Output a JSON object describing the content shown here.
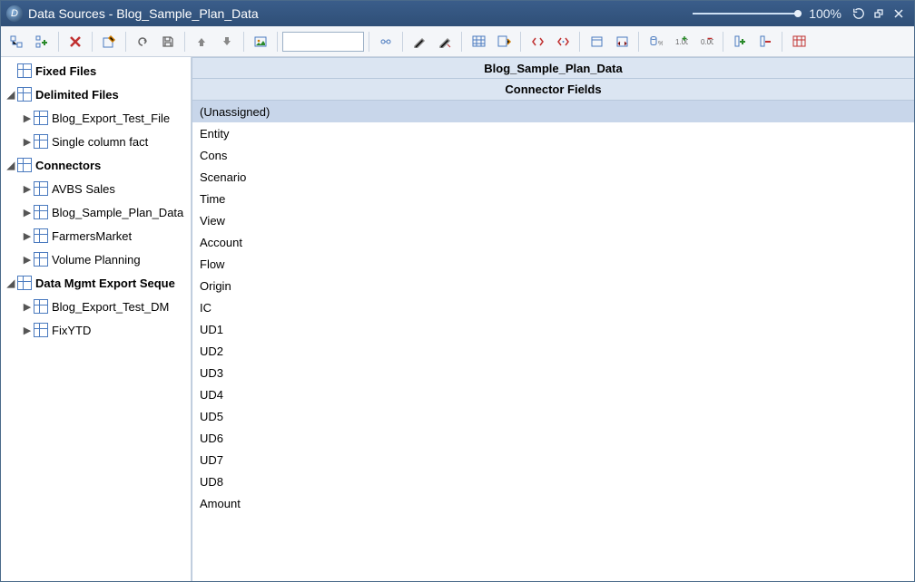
{
  "titlebar": {
    "app": "Data Sources - Blog_Sample_Plan_Data",
    "zoom_pct": "100%"
  },
  "toolbar": {
    "search_placeholder": ""
  },
  "tree": {
    "fixed_files": {
      "label": "Fixed Files"
    },
    "delimited_files": {
      "label": "Delimited Files",
      "items": [
        {
          "label": "Blog_Export_Test_File"
        },
        {
          "label": "Single column fact"
        }
      ]
    },
    "connectors": {
      "label": "Connectors",
      "items": [
        {
          "label": "AVBS Sales"
        },
        {
          "label": "Blog_Sample_Plan_Data"
        },
        {
          "label": "FarmersMarket"
        },
        {
          "label": "Volume Planning"
        }
      ]
    },
    "dm_export": {
      "label": "Data Mgmt Export Seque",
      "items": [
        {
          "label": "Blog_Export_Test_DM"
        },
        {
          "label": "FixYTD"
        }
      ]
    }
  },
  "main": {
    "title": "Blog_Sample_Plan_Data",
    "subtitle": "Connector Fields",
    "fields": [
      "(Unassigned)",
      "Entity",
      "Cons",
      "Scenario",
      "Time",
      "View",
      "Account",
      "Flow",
      "Origin",
      "IC",
      "UD1",
      "UD2",
      "UD3",
      "UD4",
      "UD5",
      "UD6",
      "UD7",
      "UD8",
      "Amount"
    ],
    "selected_index": 0
  }
}
